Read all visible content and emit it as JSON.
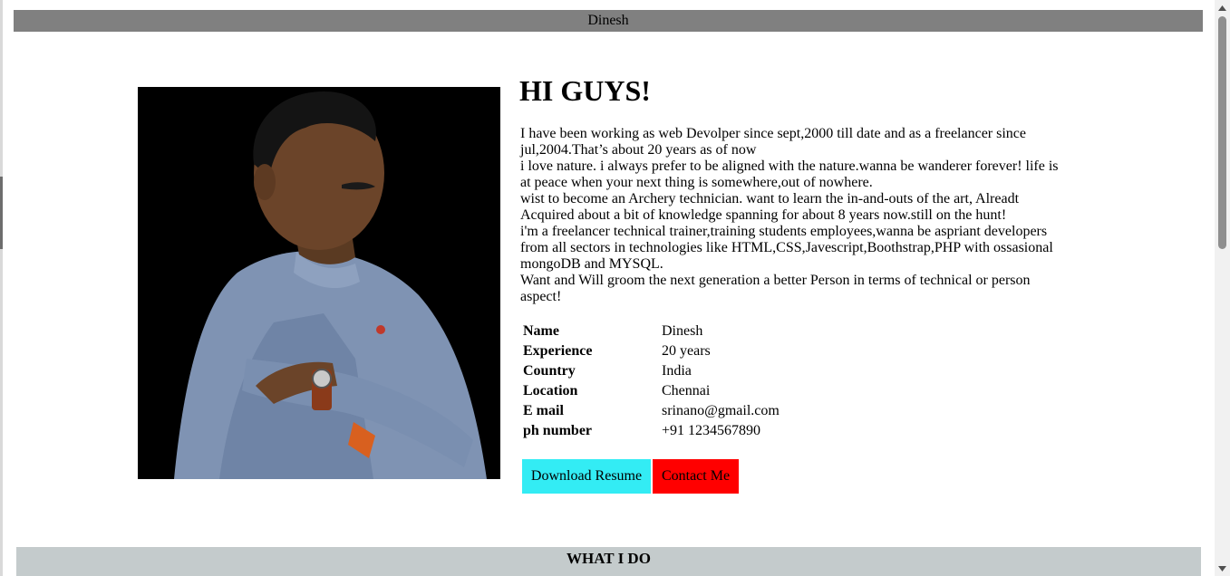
{
  "header": {
    "name": "Dinesh"
  },
  "hero": {
    "heading": "HI GUYS!",
    "bio_lines": [
      "I have been working as web Devolper since sept,2000 till date and as a freelancer since jul,2004.That’s about 20 years as of now",
      "i love nature. i always prefer to be aligned with the nature.wanna be wanderer forever! life is at peace when your next thing is somewhere,out of nowhere.",
      "wist to become an Archery technician. want to learn the in-and-outs of the art, Alreadt Acquired about a bit of knowledge spanning for about 8 years now.still on the hunt!",
      "i'm a freelancer technical trainer,training students employees,wanna be aspriant developers from all sectors in technologies like HTML,CSS,Javescript,Boothstrap,PHP with ossasional mongoDB and MYSQL.",
      "Want and Will groom the next generation a better Person in terms of technical or person aspect!"
    ]
  },
  "details": [
    {
      "label": "Name",
      "value": "Dinesh"
    },
    {
      "label": "Experience",
      "value": "20 years"
    },
    {
      "label": "Country",
      "value": "India"
    },
    {
      "label": "Location",
      "value": "Chennai"
    },
    {
      "label": "E mail",
      "value": "srinano@gmail.com"
    },
    {
      "label": "ph number",
      "value": "+91 1234567890"
    }
  ],
  "buttons": {
    "download": "Download Resume",
    "contact": "Contact Me"
  },
  "section": {
    "title": "WHAT I DO"
  },
  "colors": {
    "top_bar": "#808080",
    "download_button": "#33ecf4",
    "contact_button": "#ff0000",
    "section_bar": "#c4cbcc"
  }
}
